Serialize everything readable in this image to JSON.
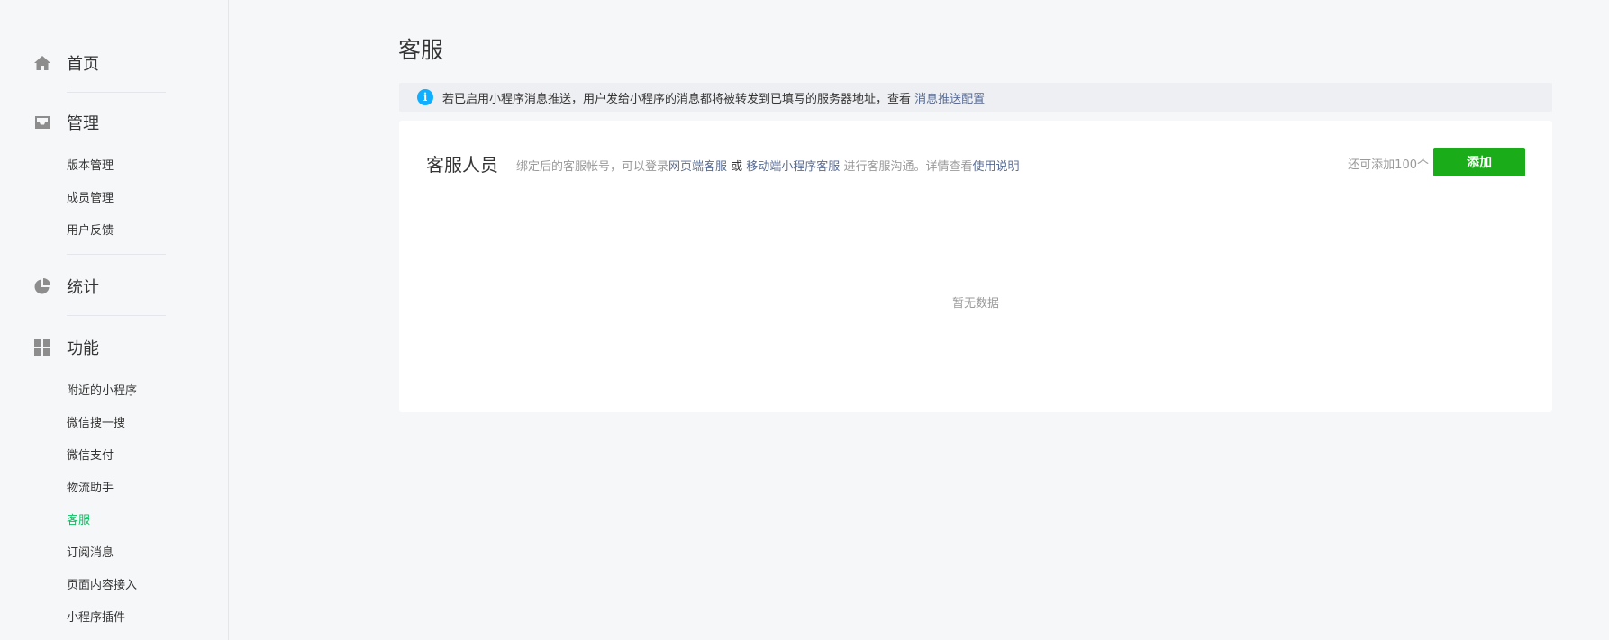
{
  "sidebar": {
    "home": {
      "label": "首页",
      "icon": "home-icon"
    },
    "manage": {
      "label": "管理",
      "icon": "inbox-icon",
      "items": [
        {
          "label": "版本管理"
        },
        {
          "label": "成员管理"
        },
        {
          "label": "用户反馈"
        }
      ]
    },
    "stats": {
      "label": "统计",
      "icon": "pie-chart-icon"
    },
    "features": {
      "label": "功能",
      "icon": "grid-icon",
      "items": [
        {
          "label": "附近的小程序"
        },
        {
          "label": "微信搜一搜"
        },
        {
          "label": "微信支付"
        },
        {
          "label": "物流助手"
        },
        {
          "label": "客服",
          "active": true
        },
        {
          "label": "订阅消息"
        },
        {
          "label": "页面内容接入"
        },
        {
          "label": "小程序插件"
        }
      ]
    }
  },
  "main": {
    "title": "客服",
    "notice": {
      "icon": "info-icon",
      "icon_glyph": "i",
      "text": "若已启用小程序消息推送，用户发给小程序的消息都将被转发到已填写的服务器地址，查看 ",
      "link": "消息推送配置"
    },
    "card": {
      "title": "客服人员",
      "desc_prefix": "绑定后的客服帐号，可以登录",
      "desc_link1": "网页端客服",
      "desc_or": " 或 ",
      "desc_link2": "移动端小程序客服",
      "desc_mid": " 进行客服沟通。详情查看",
      "desc_link3": "使用说明",
      "quota": "还可添加100个",
      "add_label": "添加",
      "empty": "暂无数据"
    }
  },
  "colors": {
    "accent": "#07c160",
    "button": "#1aad19",
    "link": "#576b95",
    "info": "#10aeff"
  }
}
